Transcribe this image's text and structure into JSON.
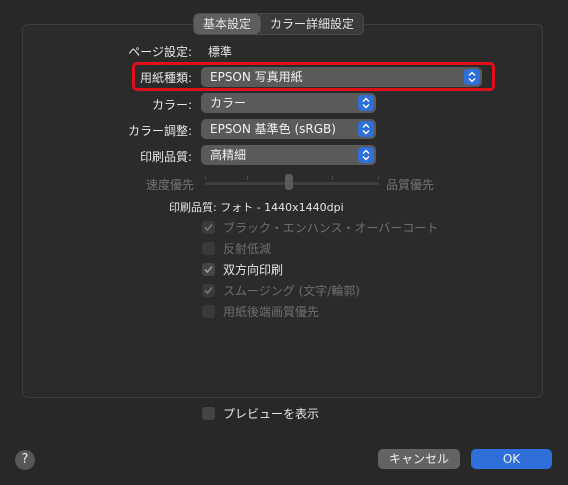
{
  "tabs": [
    "基本設定",
    "カラー詳細設定"
  ],
  "page_setup": {
    "label": "ページ設定:",
    "value": "標準"
  },
  "paper_type": {
    "label": "用紙種類:",
    "value": "EPSON 写真用紙"
  },
  "color": {
    "label": "カラー:",
    "value": "カラー"
  },
  "color_adjust": {
    "label": "カラー調整:",
    "value": "EPSON 基準色 (sRGB)"
  },
  "print_quality": {
    "label": "印刷品質:",
    "value": "高精細"
  },
  "slider": {
    "left": "速度優先",
    "right": "品質優先",
    "level": 0.5
  },
  "quality_info": "印刷品質: フォト - 1440x1440dpi",
  "options": [
    {
      "label": "ブラック・エンハンス・オーバーコート",
      "checked": true,
      "enabled": false
    },
    {
      "label": "反射低減",
      "checked": false,
      "enabled": false
    },
    {
      "label": "双方向印刷",
      "checked": true,
      "enabled": true
    },
    {
      "label": "スムージング (文字/輪郭)",
      "checked": true,
      "enabled": false
    },
    {
      "label": "用紙後端画質優先",
      "checked": false,
      "enabled": false
    }
  ],
  "preview": {
    "label": "プレビューを表示",
    "checked": false
  },
  "buttons": {
    "help": "?",
    "cancel": "キャンセル",
    "ok": "OK"
  },
  "colors": {
    "accent": "#2f6fd9",
    "highlight": "#e0101a",
    "background": "#282828"
  }
}
